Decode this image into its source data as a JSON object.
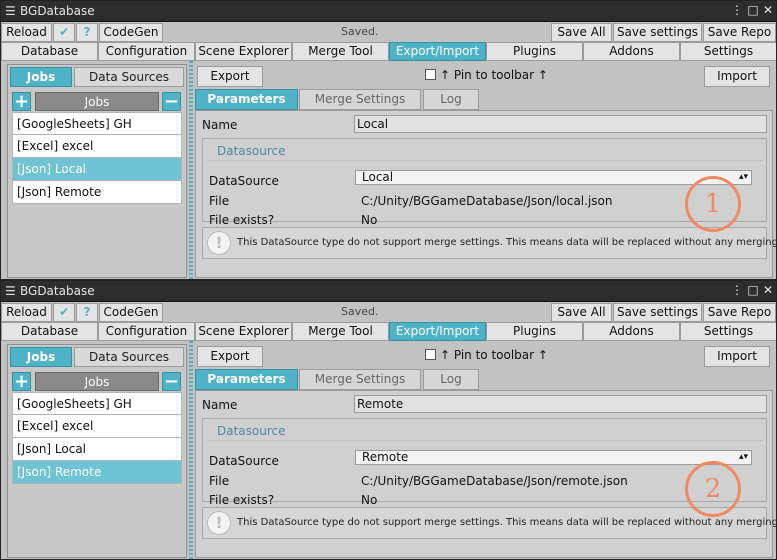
{
  "colors": {
    "accent": "#4fb3c8",
    "titlebar": "#2d2d2d",
    "badge": "#f08a62"
  },
  "icons": {
    "window": "menu-lines-icon",
    "check": "checkmark-icon",
    "help": "question-icon",
    "add": "plus-icon",
    "remove": "minus-icon",
    "info": "exclamation-icon",
    "dropdown": "dropdown-arrow-icon"
  },
  "windows": [
    {
      "title": "BGDatabase",
      "controls": {
        "more": "⋮",
        "maximize": "□",
        "close": "✕"
      },
      "toolbar": {
        "reload": "Reload",
        "check": "✔",
        "help": "?",
        "codegen": "CodeGen",
        "status": "Saved.",
        "save_all": "Save All",
        "save_settings": "Save settings",
        "save_repo": "Save Repo"
      },
      "main_tabs": [
        "Database",
        "Configuration",
        "Scene Explorer",
        "Merge Tool",
        "Export/Import",
        "Plugins",
        "Addons",
        "Settings"
      ],
      "left_tabs": [
        "Jobs",
        "Data Sources"
      ],
      "jobs_header": "Jobs",
      "jobs_add": "+",
      "jobs_remove": "−",
      "jobs": [
        "[GoogleSheets] GH",
        "[Excel] excel",
        "[Json] Local",
        "[Json] Remote"
      ],
      "export_label": "Export",
      "pin_label": "↑ Pin to toolbar ↑",
      "import_label": "Import",
      "sub_tabs": [
        "Parameters",
        "Merge Settings",
        "Log"
      ],
      "name_label": "Name",
      "name_value": "Local",
      "datasource_header": "Datasource",
      "datasource_label": "DataSource",
      "datasource_value": "Local",
      "file_label": "File",
      "file_value": "C:/Unity/BGGameDatabase/Json/local.json",
      "file_exists_label": "File exists?",
      "file_exists_value": "No",
      "info_icon": "!",
      "info_text": "This DataSource type do not support merge settings. This means data will be replaced without any merging",
      "badge": "1"
    },
    {
      "title": "BGDatabase",
      "controls": {
        "more": "⋮",
        "maximize": "□",
        "close": "✕"
      },
      "toolbar": {
        "reload": "Reload",
        "check": "✔",
        "help": "?",
        "codegen": "CodeGen",
        "status": "Saved.",
        "save_all": "Save All",
        "save_settings": "Save settings",
        "save_repo": "Save Repo"
      },
      "main_tabs": [
        "Database",
        "Configuration",
        "Scene Explorer",
        "Merge Tool",
        "Export/Import",
        "Plugins",
        "Addons",
        "Settings"
      ],
      "left_tabs": [
        "Jobs",
        "Data Sources"
      ],
      "jobs_header": "Jobs",
      "jobs_add": "+",
      "jobs_remove": "−",
      "jobs": [
        "[GoogleSheets] GH",
        "[Excel] excel",
        "[Json] Local",
        "[Json] Remote"
      ],
      "export_label": "Export",
      "pin_label": "↑ Pin to toolbar ↑",
      "import_label": "Import",
      "sub_tabs": [
        "Parameters",
        "Merge Settings",
        "Log"
      ],
      "name_label": "Name",
      "name_value": "Remote",
      "datasource_header": "Datasource",
      "datasource_label": "DataSource",
      "datasource_value": "Remote",
      "file_label": "File",
      "file_value": "C:/Unity/BGGameDatabase/Json/remote.json",
      "file_exists_label": "File exists?",
      "file_exists_value": "No",
      "info_icon": "!",
      "info_text": "This DataSource type do not support merge settings. This means data will be replaced without any merging",
      "badge": "2"
    }
  ]
}
